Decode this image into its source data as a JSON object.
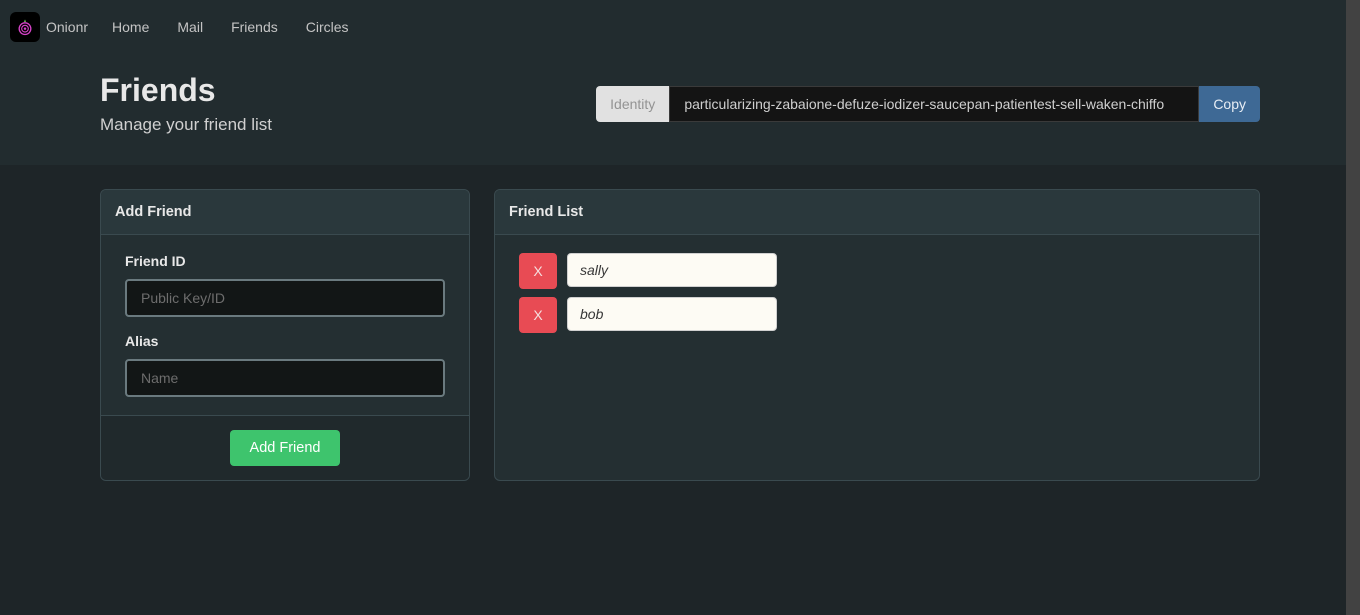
{
  "brand": {
    "name": "Onionr"
  },
  "nav": {
    "items": [
      {
        "label": "Home"
      },
      {
        "label": "Mail"
      },
      {
        "label": "Friends"
      },
      {
        "label": "Circles"
      }
    ]
  },
  "header": {
    "title": "Friends",
    "subtitle": "Manage your friend list"
  },
  "identity": {
    "label": "Identity",
    "value": "particularizing-zabaione-defuze-iodizer-saucepan-patientest-sell-waken-chiffo",
    "copy_label": "Copy"
  },
  "add_friend": {
    "card_title": "Add Friend",
    "id_label": "Friend ID",
    "id_placeholder": "Public Key/ID",
    "id_value": "",
    "alias_label": "Alias",
    "alias_placeholder": "Name",
    "alias_value": "",
    "submit_label": "Add Friend"
  },
  "friend_list": {
    "card_title": "Friend List",
    "items": [
      {
        "alias": "sally",
        "delete_label": "X"
      },
      {
        "alias": "bob",
        "delete_label": "X"
      }
    ]
  }
}
